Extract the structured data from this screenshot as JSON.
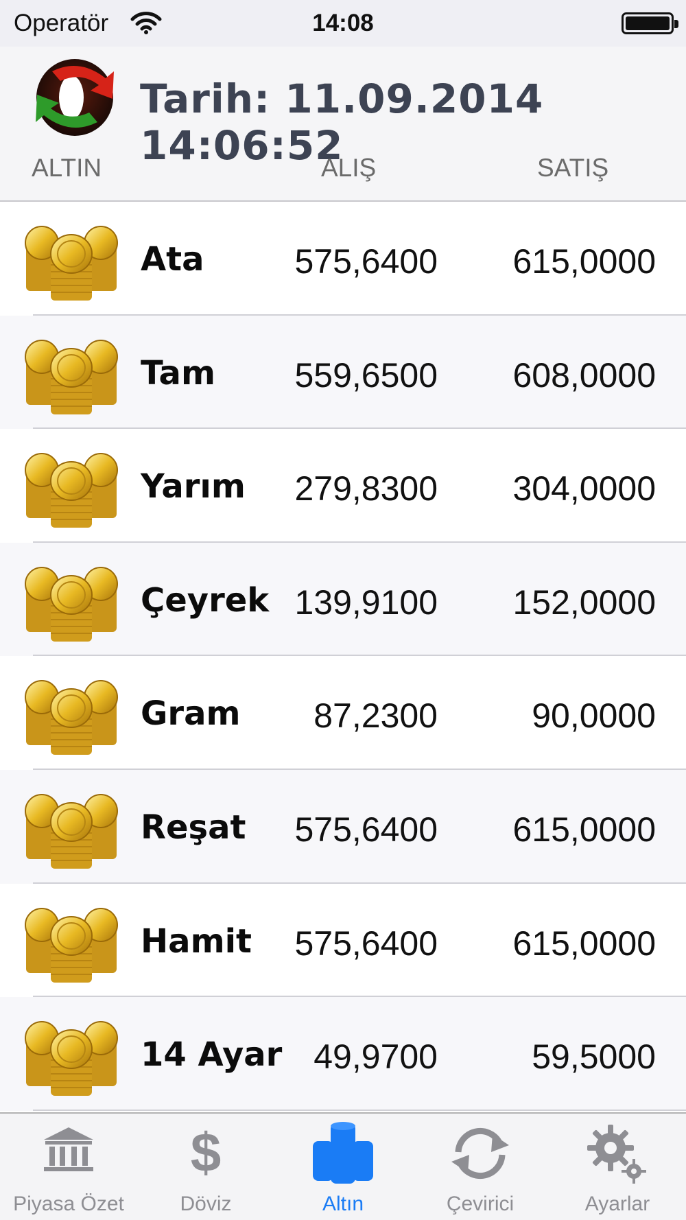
{
  "status_bar": {
    "carrier": "Operatör",
    "time": "14:08"
  },
  "header": {
    "date_text": "Tarih: 11.09.2014 14:06:52",
    "columns": {
      "name": "ALTIN",
      "buy": "ALIŞ",
      "sell": "SATIŞ"
    }
  },
  "rows": [
    {
      "name": "Ata",
      "buy": "575,6400",
      "sell": "615,0000"
    },
    {
      "name": "Tam",
      "buy": "559,6500",
      "sell": "608,0000"
    },
    {
      "name": "Yarım",
      "buy": "279,8300",
      "sell": "304,0000"
    },
    {
      "name": "Çeyrek",
      "buy": "139,9100",
      "sell": "152,0000"
    },
    {
      "name": "Gram",
      "buy": "87,2300",
      "sell": "90,0000"
    },
    {
      "name": "Reşat",
      "buy": "575,6400",
      "sell": "615,0000"
    },
    {
      "name": "Hamit",
      "buy": "575,6400",
      "sell": "615,0000"
    },
    {
      "name": "14 Ayar",
      "buy": "49,9700",
      "sell": "59,5000"
    }
  ],
  "tabs": [
    {
      "label": "Piyasa Özet",
      "icon": "bank-icon"
    },
    {
      "label": "Döviz",
      "icon": "dollar-icon"
    },
    {
      "label": "Altın",
      "icon": "gold-stack-icon",
      "active": true
    },
    {
      "label": "Çevirici",
      "icon": "convert-icon"
    },
    {
      "label": "Ayarlar",
      "icon": "gear-icon"
    }
  ],
  "colors": {
    "active_tab": "#1a7cf5",
    "inactive_tab": "#8e8e93",
    "header_text": "#3d4353"
  }
}
